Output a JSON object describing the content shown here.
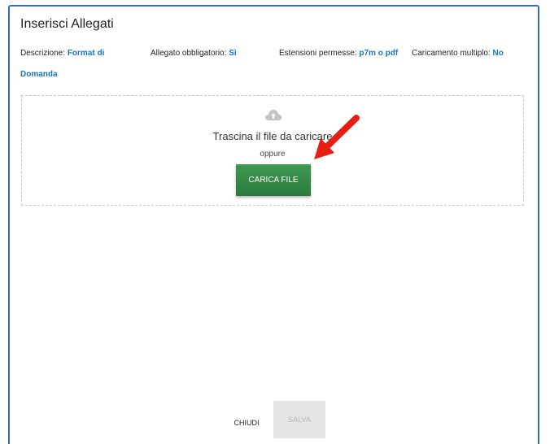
{
  "modal": {
    "title": "Inserisci Allegati"
  },
  "meta": {
    "description_label": "Descrizione:",
    "description_value": "Format di Domanda",
    "required_label": "Allegato obbligatorio:",
    "required_value": "Sì",
    "extensions_label": "Estensioni permesse:",
    "extensions_value": "p7m o pdf",
    "multiple_label": "Caricamento multiplo:",
    "multiple_value": "No"
  },
  "dropzone": {
    "icon": "cloud-upload-icon",
    "text": "Trascina il file da caricare",
    "or_text": "oppure",
    "upload_label": "CARICA FILE"
  },
  "annotation": {
    "arrow_color": "#e81d12"
  },
  "footer": {
    "close_label": "CHIUDI",
    "save_label": "SALVA"
  },
  "colors": {
    "border": "#2f6ec2",
    "accent": "#1a73c9",
    "button": "#339046"
  }
}
